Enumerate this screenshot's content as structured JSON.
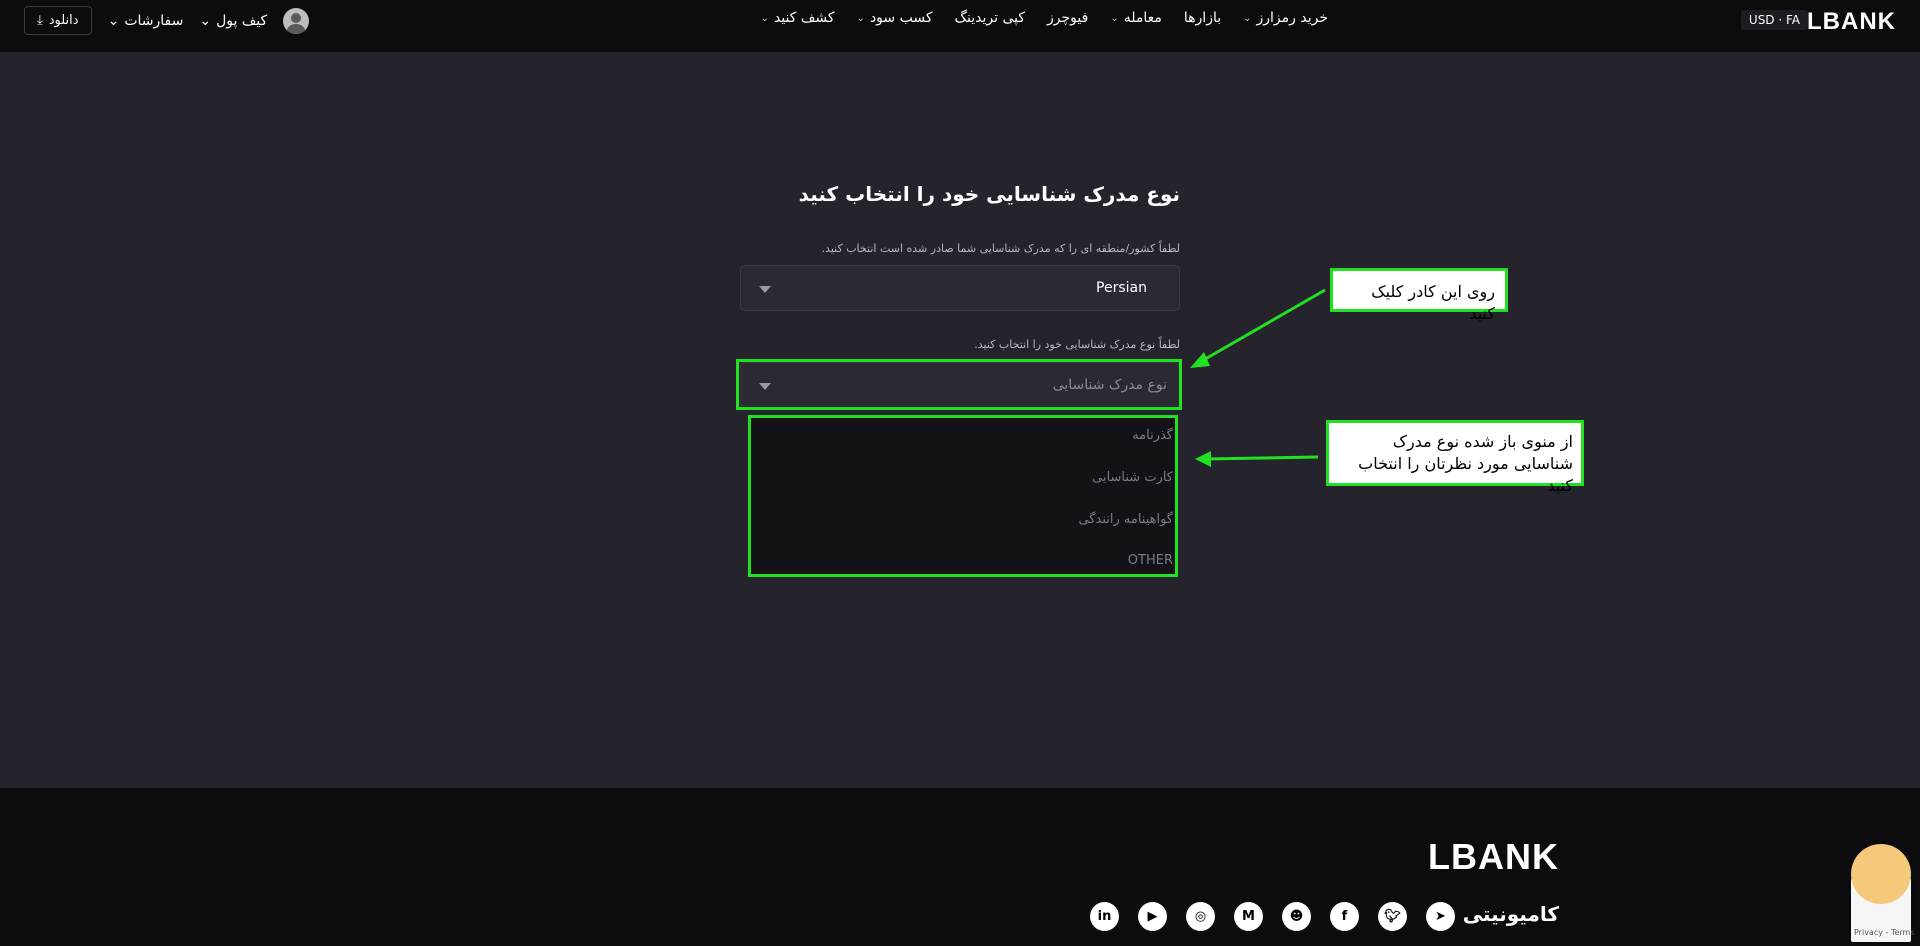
{
  "header": {
    "logo": "LBANK",
    "lang_currency": "USD · FA",
    "nav": [
      {
        "label": "خرید رمزارز",
        "dropdown": true
      },
      {
        "label": "بازارها",
        "dropdown": false
      },
      {
        "label": "معامله",
        "dropdown": true
      },
      {
        "label": "فیوچرز",
        "dropdown": false
      },
      {
        "label": "کپی تریدینگ",
        "dropdown": false
      },
      {
        "label": "کسب سود",
        "dropdown": true
      },
      {
        "label": "کشف کنید",
        "dropdown": true
      }
    ],
    "download_label": "دانلود",
    "orders_label": "سفارشات",
    "wallet_label": "کیف پول"
  },
  "form": {
    "title": "نوع مدرک شناسایی خود را انتخاب کنید",
    "country_label": "لطفاً کشور/منطقه ای را که مدرک شناسایی شما صادر شده است انتخاب کنید.",
    "country_value": "Persian",
    "doc_label": "لطفاً نوع مدرک شناسایی خود را انتخاب کنید.",
    "doc_placeholder": "نوع مدرک شناسایی",
    "doc_options": [
      "گذرنامه",
      "کارت شناسایی",
      "گواهینامه رانندگی",
      "OTHER"
    ]
  },
  "annotations": {
    "callout1": "روی این کادر کلیک کنید",
    "callout2_line1": "از منوی باز شده نوع مدرک",
    "callout2_line2": "شناسایی مورد نظرتان را انتخاب کنید",
    "color": "#22e022"
  },
  "footer": {
    "logo": "LBANK",
    "community": "کامیونیتی",
    "socials": [
      "telegram-icon",
      "twitter-icon",
      "facebook-icon",
      "reddit-icon",
      "medium-icon",
      "instagram-icon",
      "youtube-icon",
      "linkedin-icon"
    ],
    "recaptcha": "Privacy - Terms"
  }
}
